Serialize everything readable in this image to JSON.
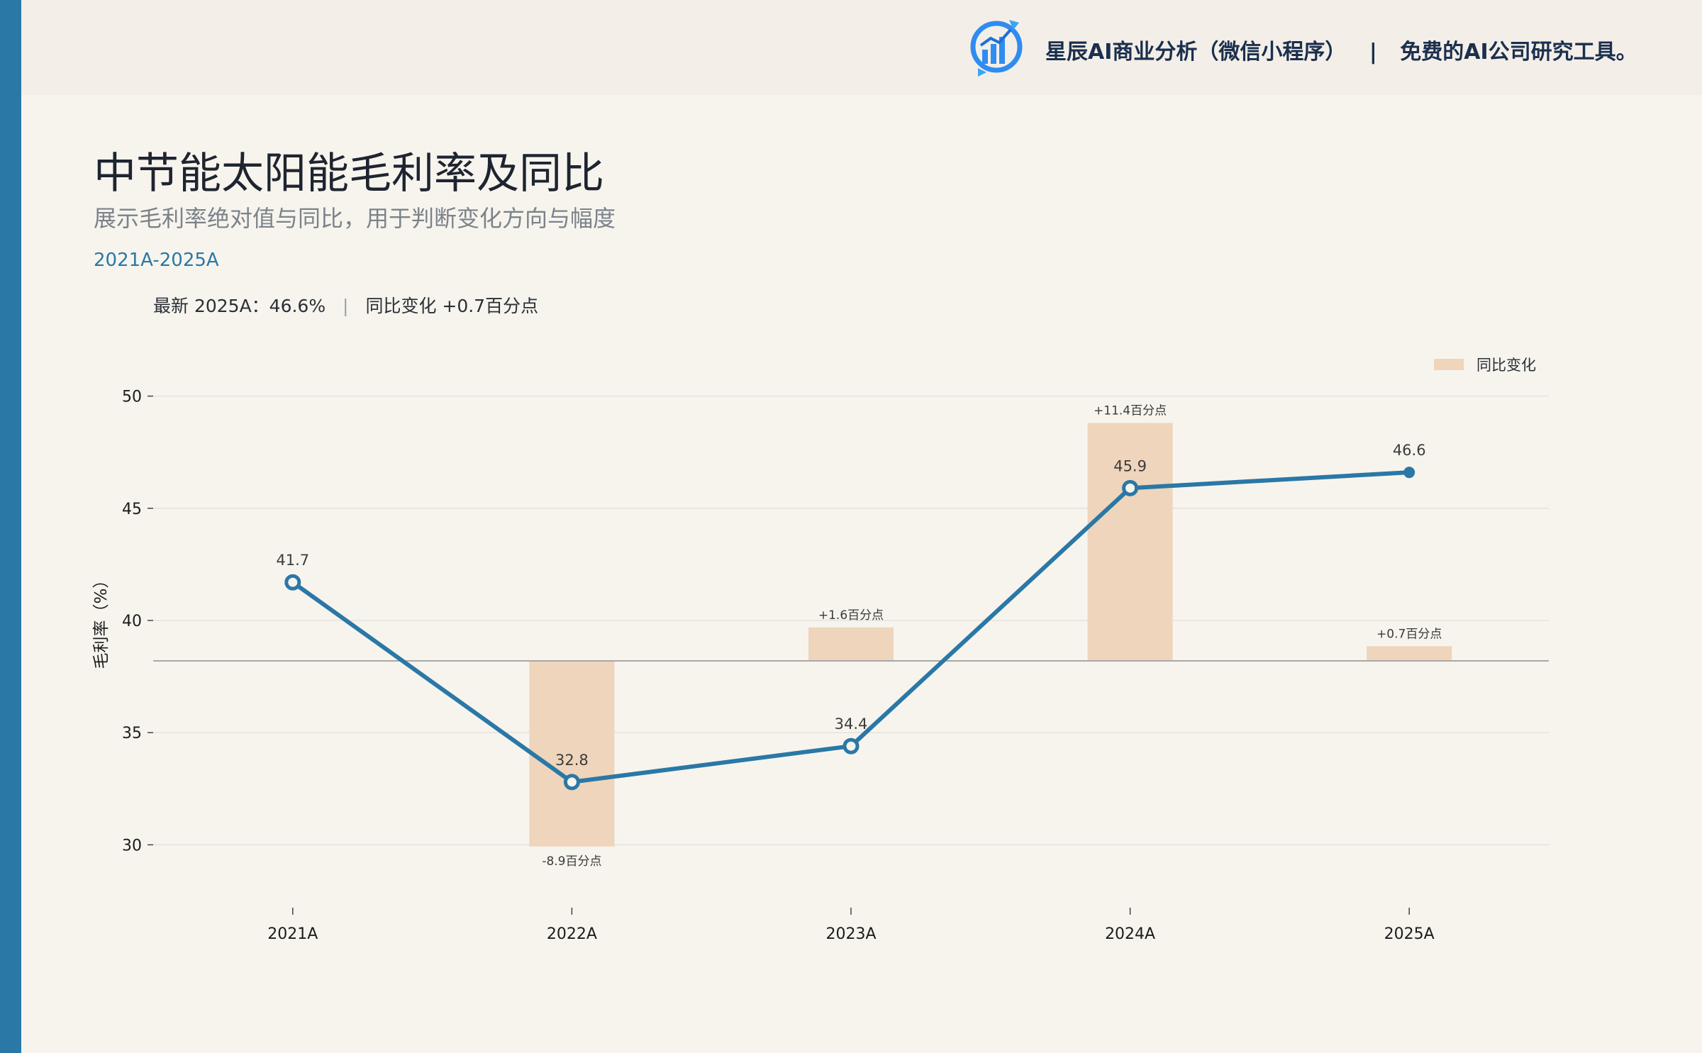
{
  "brand": {
    "name": "星辰AI商业分析（微信小程序）",
    "separator": "|",
    "tagline": "免费的AI公司研究工具。",
    "logo_icon": "bar-chart-refresh-icon"
  },
  "header": {
    "title": "中节能太阳能毛利率及同比",
    "subtitle": "展示毛利率绝对值与同比，用于判断变化方向与幅度",
    "period": "2021A-2025A"
  },
  "summary": {
    "latest": "最新 2025A：46.6%",
    "separator": "|",
    "yoy": "同比变化 +0.7百分点"
  },
  "colors": {
    "line": "#2a78a6",
    "bar": "#eed5bb",
    "accent_stripe": "#2a78a6",
    "background": "#f7f4ee"
  },
  "chart_data": {
    "type": "line",
    "categories": [
      "2021A",
      "2022A",
      "2023A",
      "2024A",
      "2025A"
    ],
    "ylabel": "毛利率（%）",
    "ylim": [
      27.2,
      52.8
    ],
    "yticks": [
      30,
      35,
      40,
      45,
      50
    ],
    "grid": true,
    "legend_position": "top-right",
    "series": [
      {
        "type": "line",
        "values": [
          41.7,
          32.8,
          34.4,
          45.9,
          46.6
        ],
        "labels": [
          "41.7",
          "32.8",
          "34.4",
          "45.9",
          "46.6"
        ]
      },
      {
        "type": "bar",
        "name": "同比变化",
        "values": [
          null,
          -8.9,
          1.6,
          11.4,
          0.7
        ],
        "labels": [
          "",
          "-8.9百分点",
          "+1.6百分点",
          "+11.4百分点",
          "+0.7百分点"
        ]
      }
    ]
  }
}
